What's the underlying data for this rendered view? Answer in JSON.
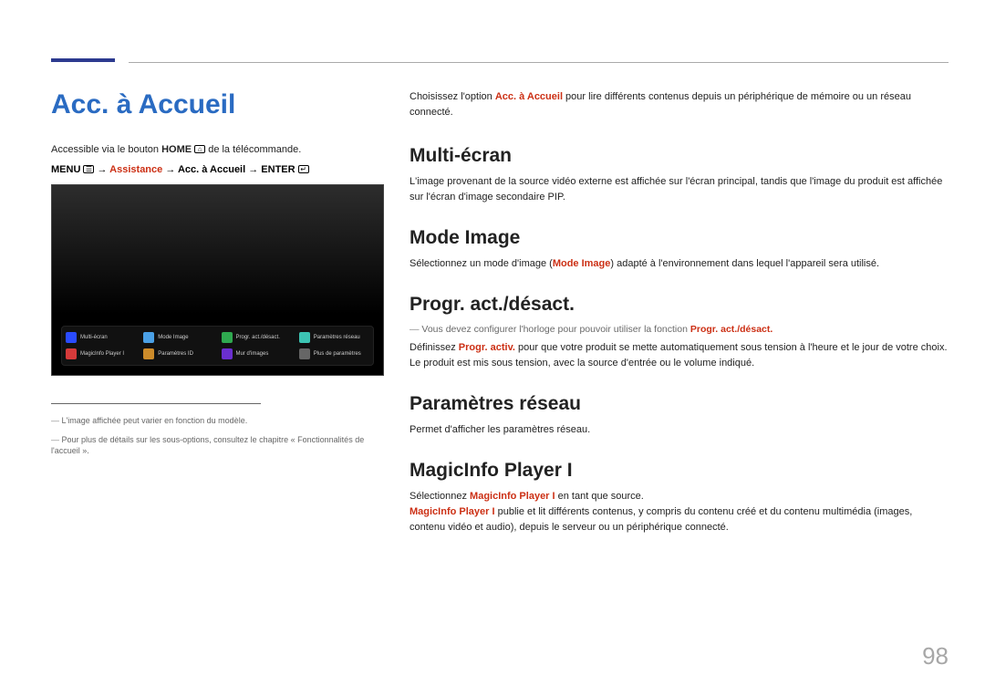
{
  "header": {
    "title": "Acc. à Accueil"
  },
  "leftPanel": {
    "introLine_pre": "Accessible via le bouton ",
    "introLine_bold": "HOME",
    "introLine_post": " de la télécommande.",
    "path": {
      "p1": "MENU ",
      "arrow": " → ",
      "assist": "Assistance",
      "acc": "Acc. à Accueil",
      "enter": "ENTER "
    },
    "screenshot": {
      "row1": [
        {
          "label": "Multi-écran",
          "color": "#2a4bff"
        },
        {
          "label": "Mode Image",
          "color": "#4aa0e6"
        },
        {
          "label": "Progr. act./désact.",
          "color": "#2fa84f"
        },
        {
          "label": "Paramètres réseau",
          "color": "#3cc4b3"
        }
      ],
      "row2": [
        {
          "label": "MagicInfo Player I",
          "color": "#d63a3a"
        },
        {
          "label": "Paramètres ID",
          "color": "#cc8b2a"
        },
        {
          "label": "Mur d'images",
          "color": "#6a2fcf"
        },
        {
          "label": "Plus de paramètres",
          "color": "#666"
        }
      ]
    },
    "notes": [
      "L'image affichée peut varier en fonction du modèle.",
      "Pour plus de détails sur les sous-options, consultez le chapitre « Fonctionnalités de l'accueil »."
    ]
  },
  "rightPanel": {
    "intro_pre": "Choisissez l'option ",
    "intro_accent": "Acc. à Accueil",
    "intro_post": " pour lire différents contenus depuis un périphérique de mémoire ou un réseau connecté.",
    "sections": {
      "multiEcran": {
        "title": "Multi-écran",
        "body": "L'image provenant de la source vidéo externe est affichée sur l'écran principal, tandis que l'image du produit est affichée sur l'écran d'image secondaire PIP."
      },
      "modeImage": {
        "title": "Mode Image",
        "body_pre": "Sélectionnez un mode d'image (",
        "body_accent": "Mode Image",
        "body_post": ") adapté à l'environnement dans lequel l'appareil sera utilisé."
      },
      "progr": {
        "title": "Progr. act./désact.",
        "tip_pre": "Vous devez configurer l'horloge pour pouvoir utiliser la fonction ",
        "tip_accent": "Progr. act./désact.",
        "line1_pre": "Définissez ",
        "line1_accent": "Progr. activ.",
        "line1_post": " pour que votre produit se mette automatiquement sous tension à l'heure et le jour de votre choix.",
        "line2": "Le produit est mis sous tension, avec la source d'entrée ou le volume indiqué."
      },
      "reseau": {
        "title": "Paramètres réseau",
        "body": "Permet d'afficher les paramètres réseau."
      },
      "magic": {
        "title": "MagicInfo Player I",
        "l1_pre": "Sélectionnez ",
        "l1_accent": "MagicInfo Player I",
        "l1_post": " en tant que source.",
        "l2_accent": "MagicInfo Player I",
        "l2_post": " publie et lit différents contenus, y compris du contenu créé et du contenu multimédia (images, contenu vidéo et audio), depuis le serveur ou un périphérique connecté."
      }
    }
  },
  "pageNumber": "98"
}
